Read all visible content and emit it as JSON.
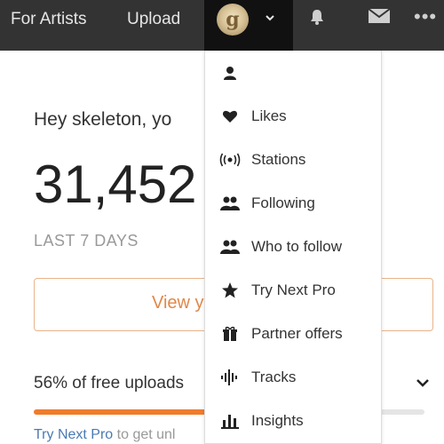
{
  "colors": {
    "topbar_bg": "#333333",
    "accent": "#f07c2c",
    "link": "#4a7ab3"
  },
  "header": {
    "nav": [
      {
        "label": "For Artists"
      },
      {
        "label": "Upload"
      }
    ],
    "avatar_icon": "user-avatar",
    "icons": [
      "chevron-down-icon",
      "bell-icon",
      "mail-icon",
      "more-icon"
    ]
  },
  "main": {
    "greeting": "Hey skeleton, yo",
    "big_number": "31,452",
    "period": "LAST 7 DAYS",
    "button_label": "View y",
    "uploads_text": "56% of free uploads",
    "uploads_fraction": 0.56,
    "promo_link": "Try Next Pro",
    "promo_rest": " to get unl"
  },
  "dropdown": {
    "items": [
      {
        "label": "",
        "icon": "user-icon"
      },
      {
        "label": "Likes",
        "icon": "heart-icon"
      },
      {
        "label": "Stations",
        "icon": "stations-icon"
      },
      {
        "label": "Following",
        "icon": "following-icon"
      },
      {
        "label": "Who to follow",
        "icon": "who-to-follow-icon"
      },
      {
        "label": "Try Next Pro",
        "icon": "star-icon"
      },
      {
        "label": "Partner offers",
        "icon": "gift-icon"
      },
      {
        "label": "Tracks",
        "icon": "waveform-icon"
      },
      {
        "label": "Insights",
        "icon": "bar-chart-icon"
      }
    ]
  }
}
